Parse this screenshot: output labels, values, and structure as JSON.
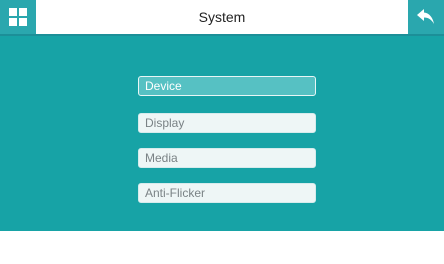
{
  "colors": {
    "accent": "#2aa7ae",
    "background": "#17a3a6",
    "selected_item": "#56c1c3",
    "item": "#eef6f6"
  },
  "header": {
    "title": "System",
    "home_icon": "grid-icon",
    "back_icon": "back-arrow-icon"
  },
  "menu": {
    "selected": "Device",
    "items": [
      {
        "label": "Device"
      },
      {
        "label": "Display"
      },
      {
        "label": "Media"
      },
      {
        "label": "Anti-Flicker"
      }
    ]
  }
}
